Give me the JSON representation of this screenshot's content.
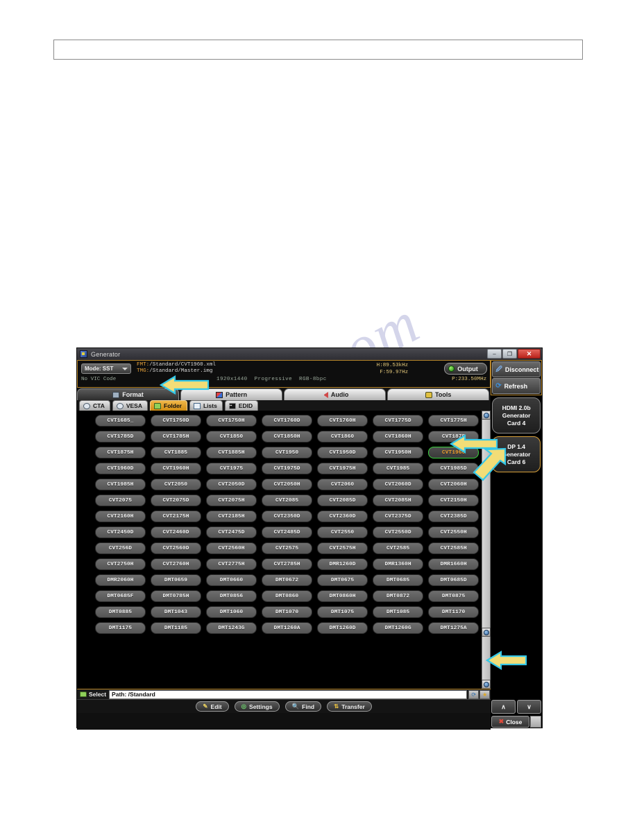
{
  "document": {
    "empty_box": ""
  },
  "window": {
    "title": "Generator",
    "icon": "app-icon",
    "controls": {
      "minimize": "–",
      "maximize": "❐",
      "close": "✕"
    }
  },
  "header": {
    "mode_label": "Mode: SST",
    "fmt_label": "FMT:",
    "fmt_value": "/Standard/CVT1960.xml",
    "tmg_label": "TMG:",
    "tmg_value": "/Standard/Master.img",
    "vic_code": "No VIC Code",
    "resolution": "1920x1440",
    "scan": "Progressive",
    "color": "RGB-8bpc",
    "h_freq": "H:89.53kHz",
    "v_freq": "F:59.97Hz",
    "pixel_clock": "P:233.50MHz",
    "output_label": "Output",
    "output_state": "on"
  },
  "tabs": [
    {
      "label": "Format",
      "icon": "monitor-icon",
      "active": true
    },
    {
      "label": "Pattern",
      "icon": "pattern-icon",
      "active": false
    },
    {
      "label": "Audio",
      "icon": "speaker-icon",
      "active": false
    },
    {
      "label": "Tools",
      "icon": "tools-icon",
      "active": false
    }
  ],
  "subtabs": [
    {
      "label": "CTA",
      "icon": "magnifier-icon",
      "active": false
    },
    {
      "label": "VESA",
      "icon": "magnifier-icon",
      "active": false
    },
    {
      "label": "Folder",
      "icon": "folder-icon",
      "active": true
    },
    {
      "label": "Lists",
      "icon": "list-icon",
      "active": false
    },
    {
      "label": "EDID",
      "icon": "edid-icon",
      "active": false
    }
  ],
  "formats": [
    "CVT1685_",
    "CVT1750D",
    "CVT1750H",
    "CVT1760D",
    "CVT1760H",
    "CVT1775D",
    "CVT1775H",
    "CVT1785D",
    "CVT1785H",
    "CVT1850",
    "CVT1850H",
    "CVT1860",
    "CVT1860H",
    "CVT1875",
    "CVT1875H",
    "CVT1885",
    "CVT1885H",
    "CVT1950",
    "CVT1950D",
    "CVT1950H",
    "CVT1960",
    "CVT1960D",
    "CVT1960H",
    "CVT1975",
    "CVT1975D",
    "CVT1975H",
    "CVT1985",
    "CVT1985D",
    "CVT1985H",
    "CVT2050",
    "CVT2050D",
    "CVT2050H",
    "CVT2060",
    "CVT2060D",
    "CVT2060H",
    "CVT2075",
    "CVT2075D",
    "CVT2075H",
    "CVT2085",
    "CVT2085D",
    "CVT2085H",
    "CVT2150H",
    "CVT2160H",
    "CVT2175H",
    "CVT2185H",
    "CVT2350D",
    "CVT2360D",
    "CVT2375D",
    "CVT2385D",
    "CVT2450D",
    "CVT2460D",
    "CVT2475D",
    "CVT2485D",
    "CVT2550",
    "CVT2550D",
    "CVT2550H",
    "CVT256D",
    "CVT2560D",
    "CVT2560H",
    "CVT2575",
    "CVT2575H",
    "CVT2585",
    "CVT2585H",
    "CVT2750H",
    "CVT2760H",
    "CVT2775H",
    "CVT2785H",
    "DMR1260D",
    "DMR1360H",
    "DMR1660H",
    "DMR2060H",
    "DMT0659",
    "DMT0660",
    "DMT0672",
    "DMT0675",
    "DMT0685",
    "DMT0685D",
    "DMT0685F",
    "DMT0785H",
    "DMT0856",
    "DMT0860",
    "DMT0860H",
    "DMT0872",
    "DMT0875",
    "DMT0885",
    "DMT1043",
    "DMT1060",
    "DMT1070",
    "DMT1075",
    "DMT1085",
    "DMT1170",
    "DMT1175",
    "DMT1185",
    "DMT1243G",
    "DMT1260A",
    "DMT1260D",
    "DMT1260G",
    "DMT1275A"
  ],
  "selected_format": "CVT1960",
  "right_panel": {
    "disconnect_label": "Disconnect",
    "refresh_label": "Refresh",
    "cards": [
      {
        "lines": [
          "HDMI 2.0b",
          "Generator",
          "Card 4"
        ],
        "active": false
      },
      {
        "lines": [
          "DP 1.4",
          "Generator",
          "Card 6"
        ],
        "active": true
      }
    ]
  },
  "bottom": {
    "select_label": "Select",
    "path_value": "Path: /Standard",
    "path_icons": [
      "refresh-icon",
      "favorite-icon"
    ],
    "actions": [
      {
        "label": "Edit",
        "icon": "edit-icon"
      },
      {
        "label": "Settings",
        "icon": "gear-icon"
      },
      {
        "label": "Find",
        "icon": "find-icon"
      },
      {
        "label": "Transfer",
        "icon": "transfer-icon"
      }
    ],
    "nav_up": "∧",
    "nav_down": "∨",
    "close_label": "Close"
  },
  "annotations": {
    "arrow_color": "#f2dd77",
    "arrow_outline": "#35c8e8",
    "arrows": [
      {
        "name": "arrow-tmg-path",
        "direction": "left"
      },
      {
        "name": "arrow-format-row",
        "direction": "left"
      },
      {
        "name": "arrow-dp-card",
        "direction": "up-right"
      },
      {
        "name": "arrow-scrollbar",
        "direction": "left"
      }
    ]
  },
  "watermark": {
    "text": "live.com"
  }
}
